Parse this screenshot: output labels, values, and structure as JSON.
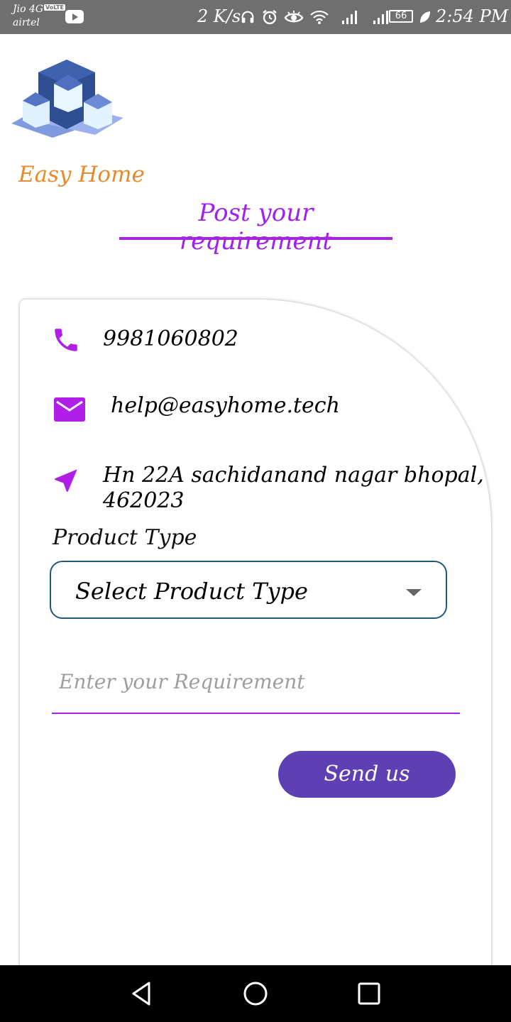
{
  "status_bar": {
    "carrier_line1": "Jio 4G",
    "carrier_line2": "airtel",
    "volte_badge": "VoLTE",
    "network_speed": "2 K/s",
    "battery_level": "66",
    "time": "2:54 PM",
    "icons": [
      "headphones-icon",
      "alarm-icon",
      "eye-icon",
      "wifi-icon",
      "signal-icon",
      "signal-icon",
      "battery-icon",
      "leaf-icon"
    ]
  },
  "header": {
    "brand_name": "Easy Home",
    "page_title": "Post your requirement"
  },
  "contact": {
    "phone": "9981060802",
    "email": "help@easyhome.tech",
    "address_line1": "Hn 22A  sachidanand nagar bhopal,",
    "address_line2": "462023"
  },
  "form": {
    "product_type_label": "Product Type",
    "product_type_selected": "Select Product Type",
    "requirement_placeholder": "Enter your Requirement",
    "submit_label": "Send us"
  },
  "colors": {
    "accent": "#a020f0",
    "brand": "#e88a2a",
    "button": "#5e3fb4",
    "select_border": "#1e5a78"
  },
  "nav": {
    "buttons": [
      "back-icon",
      "home-icon",
      "recents-icon"
    ]
  }
}
